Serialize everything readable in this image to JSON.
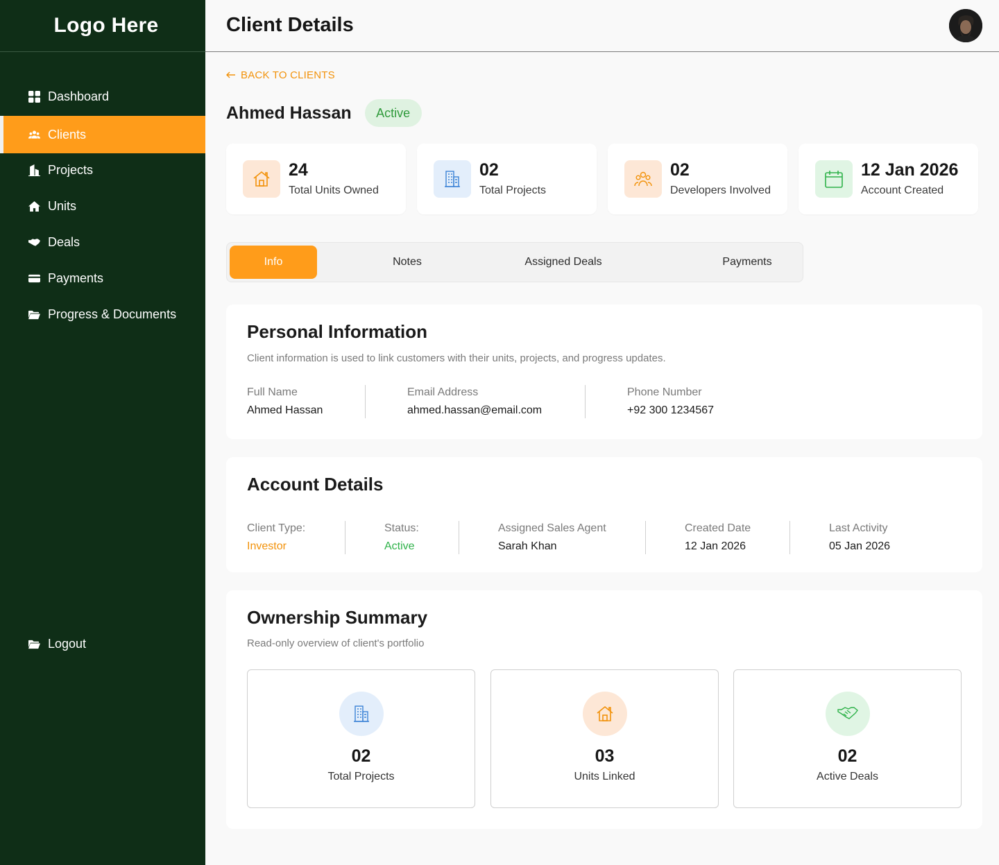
{
  "brand": {
    "logo": "Logo Here",
    "accent": "#ff9c1a",
    "sidebar_bg": "#0f2e17"
  },
  "sidebar": {
    "items": [
      {
        "label": "Dashboard",
        "icon": "grid-icon",
        "active": false
      },
      {
        "label": "Clients",
        "icon": "users-icon",
        "active": true
      },
      {
        "label": "Projects",
        "icon": "building-icon",
        "active": false
      },
      {
        "label": "Units",
        "icon": "home-icon",
        "active": false
      },
      {
        "label": "Deals",
        "icon": "handshake-icon",
        "active": false
      },
      {
        "label": "Payments",
        "icon": "credit-card-icon",
        "active": false
      },
      {
        "label": "Progress & Documents",
        "icon": "folder-icon",
        "active": false
      }
    ],
    "logout": {
      "label": "Logout",
      "icon": "folder-icon"
    }
  },
  "header": {
    "title": "Client Details",
    "avatar": "user-avatar"
  },
  "back_link": {
    "label": "BACK TO CLIENTS",
    "icon": "arrow-left-icon"
  },
  "client": {
    "name": "Ahmed Hassan",
    "status": "Active"
  },
  "stats": [
    {
      "value": "24",
      "label": "Total Units Owned",
      "icon": "home-icon"
    },
    {
      "value": "02",
      "label": "Total Projects",
      "icon": "building-icon"
    },
    {
      "value": "02",
      "label": "Developers Involved",
      "icon": "users-icon"
    },
    {
      "value": "12 Jan 2026",
      "label": "Account Created",
      "icon": "calendar-icon"
    }
  ],
  "tabs": [
    {
      "label": "Info",
      "active": true
    },
    {
      "label": "Notes",
      "active": false
    },
    {
      "label": "Assigned Deals",
      "active": false
    },
    {
      "label": "Payments",
      "active": false
    }
  ],
  "personal": {
    "title": "Personal Information",
    "subtitle": "Client information is used to link customers with their units, projects, and progress updates.",
    "fields": [
      {
        "label": "Full Name",
        "value": "Ahmed Hassan"
      },
      {
        "label": "Email Address",
        "value": "ahmed.hassan@email.com"
      },
      {
        "label": "Phone Number",
        "value": "+92 300 1234567"
      }
    ]
  },
  "account": {
    "title": "Account Details",
    "fields": [
      {
        "label": "Client Type:",
        "value": "Investor",
        "color": "#f2920a"
      },
      {
        "label": "Status:",
        "value": "Active",
        "color": "#2f9a3b"
      },
      {
        "label": "Assigned Sales Agent",
        "value": "Sarah Khan"
      },
      {
        "label": "Created Date",
        "value": "12 Jan 2026"
      },
      {
        "label": "Last Activity",
        "value": "05 Jan 2026"
      }
    ]
  },
  "ownership": {
    "title": "Ownership Summary",
    "subtitle": "Read-only overview of client's portfolio",
    "items": [
      {
        "value": "02",
        "label": "Total Projects",
        "icon": "building-icon"
      },
      {
        "value": "03",
        "label": "Units Linked",
        "icon": "home-icon"
      },
      {
        "value": "02",
        "label": "Active Deals",
        "icon": "handshake-icon"
      }
    ]
  }
}
